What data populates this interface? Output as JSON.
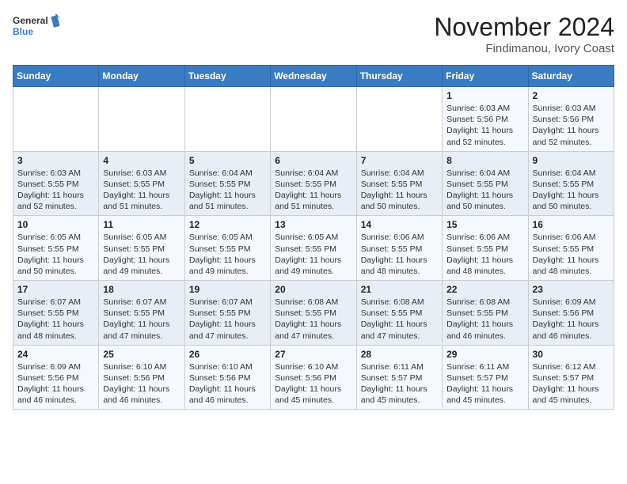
{
  "header": {
    "logo_line1": "General",
    "logo_line2": "Blue",
    "month": "November 2024",
    "location": "Findimanou, Ivory Coast"
  },
  "weekdays": [
    "Sunday",
    "Monday",
    "Tuesday",
    "Wednesday",
    "Thursday",
    "Friday",
    "Saturday"
  ],
  "weeks": [
    [
      {
        "day": "",
        "info": ""
      },
      {
        "day": "",
        "info": ""
      },
      {
        "day": "",
        "info": ""
      },
      {
        "day": "",
        "info": ""
      },
      {
        "day": "",
        "info": ""
      },
      {
        "day": "1",
        "info": "Sunrise: 6:03 AM\nSunset: 5:56 PM\nDaylight: 11 hours and 52 minutes."
      },
      {
        "day": "2",
        "info": "Sunrise: 6:03 AM\nSunset: 5:56 PM\nDaylight: 11 hours and 52 minutes."
      }
    ],
    [
      {
        "day": "3",
        "info": "Sunrise: 6:03 AM\nSunset: 5:55 PM\nDaylight: 11 hours and 52 minutes."
      },
      {
        "day": "4",
        "info": "Sunrise: 6:03 AM\nSunset: 5:55 PM\nDaylight: 11 hours and 51 minutes."
      },
      {
        "day": "5",
        "info": "Sunrise: 6:04 AM\nSunset: 5:55 PM\nDaylight: 11 hours and 51 minutes."
      },
      {
        "day": "6",
        "info": "Sunrise: 6:04 AM\nSunset: 5:55 PM\nDaylight: 11 hours and 51 minutes."
      },
      {
        "day": "7",
        "info": "Sunrise: 6:04 AM\nSunset: 5:55 PM\nDaylight: 11 hours and 50 minutes."
      },
      {
        "day": "8",
        "info": "Sunrise: 6:04 AM\nSunset: 5:55 PM\nDaylight: 11 hours and 50 minutes."
      },
      {
        "day": "9",
        "info": "Sunrise: 6:04 AM\nSunset: 5:55 PM\nDaylight: 11 hours and 50 minutes."
      }
    ],
    [
      {
        "day": "10",
        "info": "Sunrise: 6:05 AM\nSunset: 5:55 PM\nDaylight: 11 hours and 50 minutes."
      },
      {
        "day": "11",
        "info": "Sunrise: 6:05 AM\nSunset: 5:55 PM\nDaylight: 11 hours and 49 minutes."
      },
      {
        "day": "12",
        "info": "Sunrise: 6:05 AM\nSunset: 5:55 PM\nDaylight: 11 hours and 49 minutes."
      },
      {
        "day": "13",
        "info": "Sunrise: 6:05 AM\nSunset: 5:55 PM\nDaylight: 11 hours and 49 minutes."
      },
      {
        "day": "14",
        "info": "Sunrise: 6:06 AM\nSunset: 5:55 PM\nDaylight: 11 hours and 48 minutes."
      },
      {
        "day": "15",
        "info": "Sunrise: 6:06 AM\nSunset: 5:55 PM\nDaylight: 11 hours and 48 minutes."
      },
      {
        "day": "16",
        "info": "Sunrise: 6:06 AM\nSunset: 5:55 PM\nDaylight: 11 hours and 48 minutes."
      }
    ],
    [
      {
        "day": "17",
        "info": "Sunrise: 6:07 AM\nSunset: 5:55 PM\nDaylight: 11 hours and 48 minutes."
      },
      {
        "day": "18",
        "info": "Sunrise: 6:07 AM\nSunset: 5:55 PM\nDaylight: 11 hours and 47 minutes."
      },
      {
        "day": "19",
        "info": "Sunrise: 6:07 AM\nSunset: 5:55 PM\nDaylight: 11 hours and 47 minutes."
      },
      {
        "day": "20",
        "info": "Sunrise: 6:08 AM\nSunset: 5:55 PM\nDaylight: 11 hours and 47 minutes."
      },
      {
        "day": "21",
        "info": "Sunrise: 6:08 AM\nSunset: 5:55 PM\nDaylight: 11 hours and 47 minutes."
      },
      {
        "day": "22",
        "info": "Sunrise: 6:08 AM\nSunset: 5:55 PM\nDaylight: 11 hours and 46 minutes."
      },
      {
        "day": "23",
        "info": "Sunrise: 6:09 AM\nSunset: 5:56 PM\nDaylight: 11 hours and 46 minutes."
      }
    ],
    [
      {
        "day": "24",
        "info": "Sunrise: 6:09 AM\nSunset: 5:56 PM\nDaylight: 11 hours and 46 minutes."
      },
      {
        "day": "25",
        "info": "Sunrise: 6:10 AM\nSunset: 5:56 PM\nDaylight: 11 hours and 46 minutes."
      },
      {
        "day": "26",
        "info": "Sunrise: 6:10 AM\nSunset: 5:56 PM\nDaylight: 11 hours and 46 minutes."
      },
      {
        "day": "27",
        "info": "Sunrise: 6:10 AM\nSunset: 5:56 PM\nDaylight: 11 hours and 45 minutes."
      },
      {
        "day": "28",
        "info": "Sunrise: 6:11 AM\nSunset: 5:57 PM\nDaylight: 11 hours and 45 minutes."
      },
      {
        "day": "29",
        "info": "Sunrise: 6:11 AM\nSunset: 5:57 PM\nDaylight: 11 hours and 45 minutes."
      },
      {
        "day": "30",
        "info": "Sunrise: 6:12 AM\nSunset: 5:57 PM\nDaylight: 11 hours and 45 minutes."
      }
    ]
  ]
}
